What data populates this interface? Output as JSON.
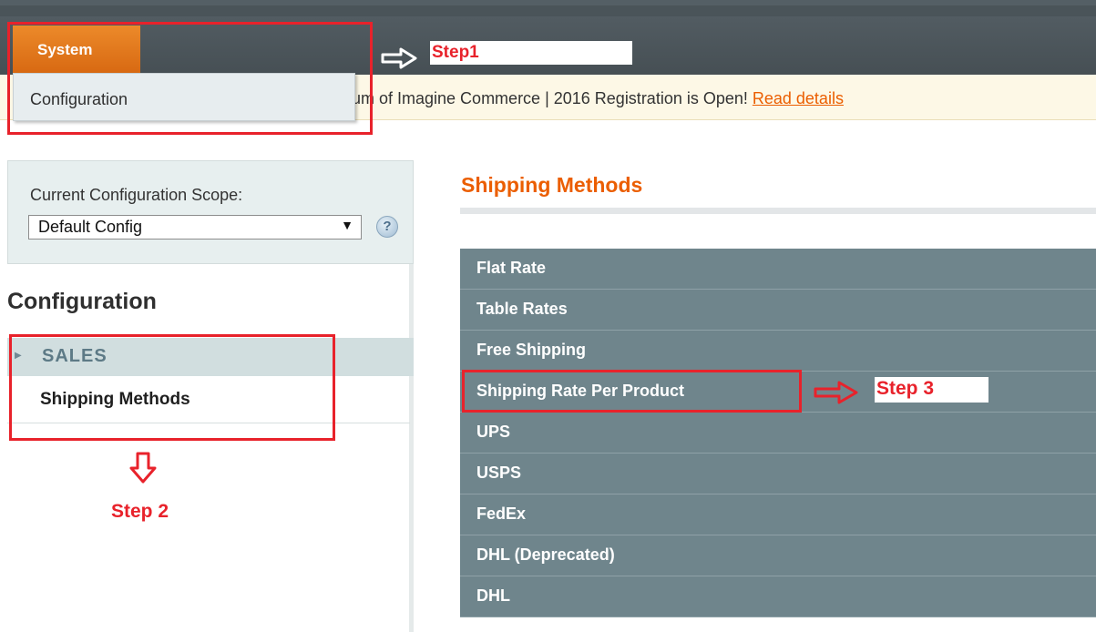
{
  "nav": {
    "system_label": "System",
    "dropdown_item": "Configuration"
  },
  "notice": {
    "text": "um of Imagine Commerce | 2016 Registration is Open! ",
    "link": "Read details"
  },
  "scope": {
    "label": "Current Configuration Scope:",
    "selected": "Default Config",
    "help_icon": "help-icon"
  },
  "sidebar": {
    "title": "Configuration",
    "group": "SALES",
    "active_item": "Shipping Methods"
  },
  "main": {
    "title": "Shipping Methods",
    "sections": [
      {
        "label": "Flat Rate"
      },
      {
        "label": "Table Rates"
      },
      {
        "label": "Free Shipping"
      },
      {
        "label": "Shipping Rate Per Product"
      },
      {
        "label": "UPS"
      },
      {
        "label": "USPS"
      },
      {
        "label": "FedEx"
      },
      {
        "label": "DHL (Deprecated)"
      },
      {
        "label": "DHL"
      }
    ]
  },
  "annotations": {
    "step1": "Step1",
    "step2": "Step 2",
    "step3": "Step 3"
  },
  "colors": {
    "accent": "#eb5e00",
    "annotation": "#e8222b",
    "section_bg": "#6f858c"
  }
}
